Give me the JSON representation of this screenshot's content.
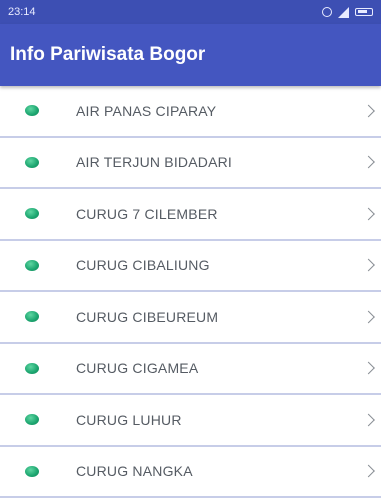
{
  "status_bar": {
    "time": "23:14",
    "icons": [
      "alarm-icon",
      "signal-icon",
      "battery-icon"
    ]
  },
  "app_bar": {
    "title": "Info Pariwisata Bogor",
    "color": "#4456c0"
  },
  "list": {
    "items": [
      {
        "label": "AIR PANAS CIPARAY"
      },
      {
        "label": "AIR TERJUN BIDADARI"
      },
      {
        "label": "CURUG 7 CILEMBER"
      },
      {
        "label": "CURUG CIBALIUNG"
      },
      {
        "label": "CURUG CIBEUREUM"
      },
      {
        "label": "CURUG CIGAMEA"
      },
      {
        "label": "CURUG LUHUR"
      },
      {
        "label": "CURUG NANGKA"
      }
    ],
    "bullet_color": "#1fa872",
    "item_icon": "green-dot-icon",
    "trailing_icon": "chevron-right-icon"
  }
}
